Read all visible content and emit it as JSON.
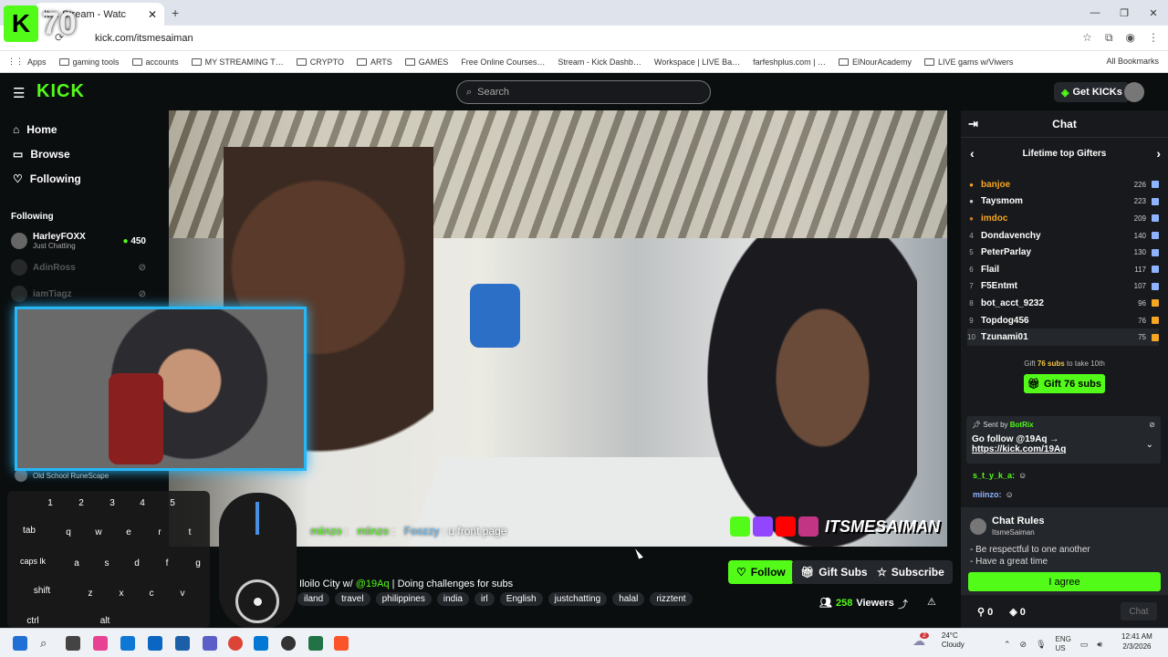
{
  "browser": {
    "tab_title": "It… Stream - Watc",
    "url": "kick.com/itsmesaiman",
    "bookmarks": [
      "Apps",
      "gaming tools",
      "accounts",
      "MY STREAMING T…",
      "CRYPTO",
      "ARTS",
      "GAMES",
      "Free Online Courses…",
      "Stream - Kick Dashb…",
      "Workspace | LIVE Ba…",
      "farfeshplus.com | …",
      "ElNourAcademy",
      "LIVE gams w/Viwers"
    ],
    "all_bookmarks": "All Bookmarks"
  },
  "overlay": {
    "counter": "70"
  },
  "header": {
    "logo": "KICK",
    "search_placeholder": "Search",
    "get_kicks": "Get KICKs"
  },
  "sidebar": {
    "nav": [
      {
        "label": "Home"
      },
      {
        "label": "Browse"
      },
      {
        "label": "Following"
      }
    ],
    "following_heading": "Following",
    "channels": [
      {
        "name": "HarleyFOXX",
        "sub": "Just Chatting",
        "count": "450"
      },
      {
        "name": "AdinRoss",
        "sub": ""
      },
      {
        "name": "iamTiagz",
        "sub": ""
      },
      {
        "name": "Old School RuneScape",
        "sub": ""
      }
    ]
  },
  "stream": {
    "title_prefix": "Iloilo City w/ ",
    "title_at": "@19Aq",
    "title_suffix": " | Doing challenges for subs",
    "tags": [
      "iland",
      "travel",
      "philippines",
      "india",
      "irl",
      "English",
      "justchatting",
      "halal",
      "rizztent"
    ],
    "viewers": "258",
    "viewers_label": "Viewers",
    "follow": "Follow",
    "gift_subs": "Gift Subs",
    "subscribe": "Subscribe",
    "brand_text": "ITSMESAIMAN"
  },
  "video_chat": [
    {
      "user": "miinzo",
      "text": ""
    },
    {
      "user": "miinzo",
      "text": ""
    },
    {
      "user": "Foozzy",
      "text": "u front page"
    }
  ],
  "keyboard": {
    "keys": [
      "1",
      "2",
      "3",
      "4",
      "5",
      "tab",
      "q",
      "w",
      "e",
      "r",
      "t",
      "caps lk",
      "a",
      "s",
      "d",
      "f",
      "g",
      "shift",
      "z",
      "x",
      "c",
      "v",
      "ctrl",
      "alt"
    ]
  },
  "chat": {
    "title": "Chat",
    "gifters_title": "Lifetime top Gifters",
    "gifters": [
      {
        "rank": "",
        "name": "banjoe",
        "count": "226"
      },
      {
        "rank": "",
        "name": "Taysmom",
        "count": "223"
      },
      {
        "rank": "",
        "name": "imdoc",
        "count": "209"
      },
      {
        "rank": "4",
        "name": "Dondavenchy",
        "count": "140"
      },
      {
        "rank": "5",
        "name": "PeterParlay",
        "count": "130"
      },
      {
        "rank": "6",
        "name": "Flail",
        "count": "117"
      },
      {
        "rank": "7",
        "name": "F5Entmt",
        "count": "107"
      },
      {
        "rank": "8",
        "name": "bot_acct_9232",
        "count": "96"
      },
      {
        "rank": "9",
        "name": "Topdog456",
        "count": "76"
      },
      {
        "rank": "10",
        "name": "Tzunami01",
        "count": "75"
      }
    ],
    "gift_note_prefix": "Gift",
    "gift_note_count": "76 subs",
    "gift_note_suffix": "to take 10th",
    "gift_button": "Gift 76 subs",
    "pinned": {
      "sent_by": "Sent by",
      "sender": "BotRix",
      "message": "Go follow @19Aq →",
      "link": "https://kick.com/19Aq"
    },
    "messages": [
      {
        "user": "s_t_y_k_a:"
      },
      {
        "user": "miinzo:"
      }
    ],
    "rules": {
      "title": "Chat Rules",
      "subtitle": "ItsmeSaiman",
      "rule1": "- Be respectful to one another",
      "rule2": "- Have a great time",
      "agree": "I agree"
    },
    "bottom": {
      "left_count": "0",
      "right_count": "0",
      "chat_button": "Chat"
    }
  },
  "taskbar": {
    "temp": "24°C",
    "weather": "Cloudy",
    "badge": "2",
    "lang1": "ENG",
    "lang2": "US",
    "time": "12:41 AM",
    "date": "2/3/2026"
  }
}
